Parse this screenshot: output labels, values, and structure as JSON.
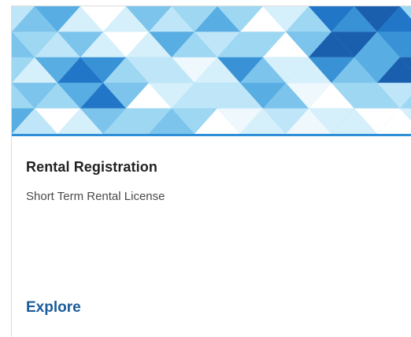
{
  "card": {
    "title": "Rental Registration",
    "subtitle": "Short Term Rental License",
    "action_label": "Explore",
    "banner_image": "blue-triangle-mosaic",
    "colors": {
      "title": "#222222",
      "subtitle": "#4a4a4a",
      "link": "#1a5b9a",
      "banner_accent": "#2f8fd6"
    }
  }
}
